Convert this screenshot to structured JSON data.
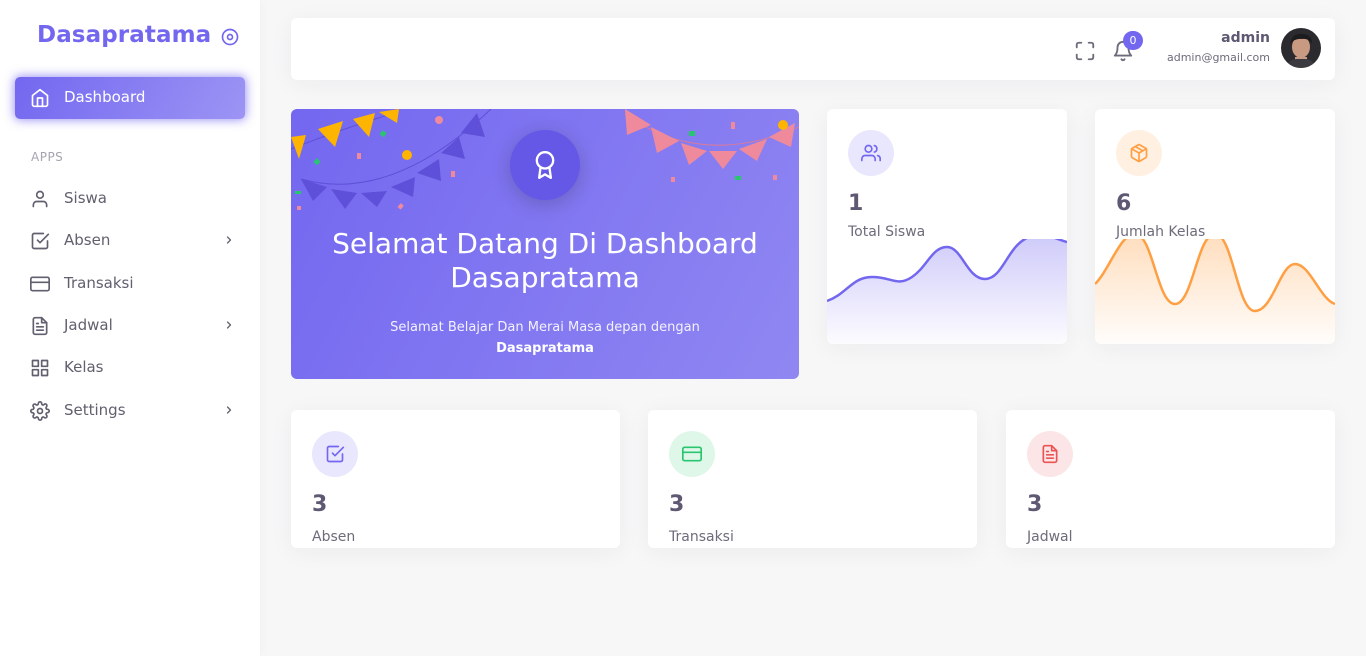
{
  "brand": {
    "name": "Dasapratama"
  },
  "sidebar": {
    "active_item": {
      "label": "Dashboard",
      "icon": "home-icon"
    },
    "section_label": "APPS",
    "items": [
      {
        "label": "Siswa",
        "icon": "user-icon",
        "has_children": false
      },
      {
        "label": "Absen",
        "icon": "check-square-icon",
        "has_children": true
      },
      {
        "label": "Transaksi",
        "icon": "credit-card-icon",
        "has_children": false
      },
      {
        "label": "Jadwal",
        "icon": "file-text-icon",
        "has_children": true
      },
      {
        "label": "Kelas",
        "icon": "grid-icon",
        "has_children": false
      },
      {
        "label": "Settings",
        "icon": "settings-icon",
        "has_children": true
      }
    ]
  },
  "header": {
    "notification_count": "0",
    "user": {
      "name": "admin",
      "email": "admin@gmail.com"
    }
  },
  "welcome": {
    "title_line1": "Selamat Datang Di Dashboard",
    "title_line2": "Dasapratama",
    "subtitle": "Selamat Belajar Dan Merai Masa depan dengan",
    "subtitle_bold": "Dasapratama"
  },
  "stats": [
    {
      "value": "1",
      "label": "Total Siswa",
      "icon": "users-icon",
      "color": "#7367f0"
    },
    {
      "value": "6",
      "label": "Jumlah Kelas",
      "icon": "package-icon",
      "color": "#ff9f43"
    }
  ],
  "cards": [
    {
      "value": "3",
      "label": "Absen",
      "icon": "check-square-icon",
      "color": "#7367f0"
    },
    {
      "value": "3",
      "label": "Transaksi",
      "icon": "credit-card-icon",
      "color": "#28c76f"
    },
    {
      "value": "3",
      "label": "Jadwal",
      "icon": "file-text-icon",
      "color": "#ea5455"
    }
  ],
  "colors": {
    "primary": "#7367f0",
    "warning": "#ff9f43",
    "success": "#28c76f",
    "danger": "#ea5455"
  }
}
